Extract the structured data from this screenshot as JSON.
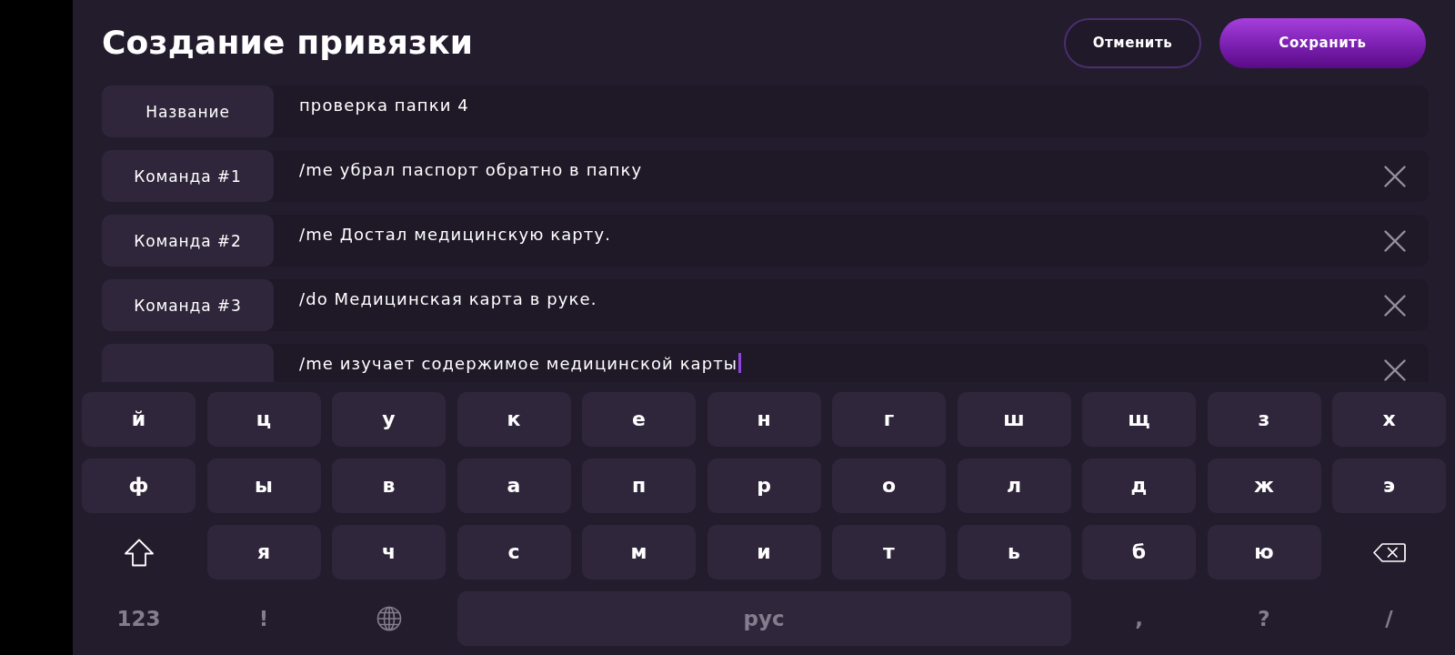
{
  "header": {
    "title": "Создание привязки",
    "buttons": [
      {
        "label": "Отменить",
        "kind": "secondary"
      },
      {
        "label": "Сохранить",
        "kind": "primary"
      }
    ]
  },
  "fields": [
    {
      "label": "Название",
      "value": "проверка папки 4",
      "removable": false,
      "focused": false
    },
    {
      "label": "Команда #1",
      "value": "/me убрал паспорт обратно в папку",
      "removable": true,
      "focused": false
    },
    {
      "label": "Команда #2",
      "value": "/me Достал медицинскую карту.",
      "removable": true,
      "focused": false
    },
    {
      "label": "Команда #3",
      "value": "/do Медицинская карта в руке.",
      "removable": true,
      "focused": false
    },
    {
      "value": "/me изучает содержимое медицинской карты",
      "removable": true,
      "focused": true
    }
  ],
  "keyboard": {
    "rows": [
      {
        "keys": [
          {
            "kind": "letter",
            "label": "й"
          },
          {
            "kind": "letter",
            "label": "ц"
          },
          {
            "kind": "letter",
            "label": "у"
          },
          {
            "kind": "letter",
            "label": "к"
          },
          {
            "kind": "letter",
            "label": "е"
          },
          {
            "kind": "letter",
            "label": "н"
          },
          {
            "kind": "letter",
            "label": "г"
          },
          {
            "kind": "letter",
            "label": "ш"
          },
          {
            "kind": "letter",
            "label": "щ"
          },
          {
            "kind": "letter",
            "label": "з"
          },
          {
            "kind": "letter",
            "label": "х"
          }
        ]
      },
      {
        "keys": [
          {
            "kind": "letter",
            "label": "ф"
          },
          {
            "kind": "letter",
            "label": "ы"
          },
          {
            "kind": "letter",
            "label": "в"
          },
          {
            "kind": "letter",
            "label": "а"
          },
          {
            "kind": "letter",
            "label": "п"
          },
          {
            "kind": "letter",
            "label": "р"
          },
          {
            "kind": "letter",
            "label": "о"
          },
          {
            "kind": "letter",
            "label": "л"
          },
          {
            "kind": "letter",
            "label": "д"
          },
          {
            "kind": "letter",
            "label": "ж"
          },
          {
            "kind": "letter",
            "label": "э"
          }
        ]
      },
      {
        "keys": [
          {
            "kind": "shift"
          },
          {
            "kind": "letter",
            "label": "я"
          },
          {
            "kind": "letter",
            "label": "ч"
          },
          {
            "kind": "letter",
            "label": "с"
          },
          {
            "kind": "letter",
            "label": "м"
          },
          {
            "kind": "letter",
            "label": "и"
          },
          {
            "kind": "letter",
            "label": "т"
          },
          {
            "kind": "letter",
            "label": "ь"
          },
          {
            "kind": "letter",
            "label": "б"
          },
          {
            "kind": "letter",
            "label": "ю"
          },
          {
            "kind": "backspace"
          }
        ]
      },
      {
        "keys": [
          {
            "kind": "symbol",
            "label": "123"
          },
          {
            "kind": "symbol",
            "label": "!"
          },
          {
            "kind": "globe"
          },
          {
            "kind": "space",
            "label": "рус"
          },
          {
            "kind": "symbol",
            "label": ","
          },
          {
            "kind": "symbol",
            "label": "?"
          },
          {
            "kind": "symbol",
            "label": "/"
          }
        ]
      }
    ]
  }
}
